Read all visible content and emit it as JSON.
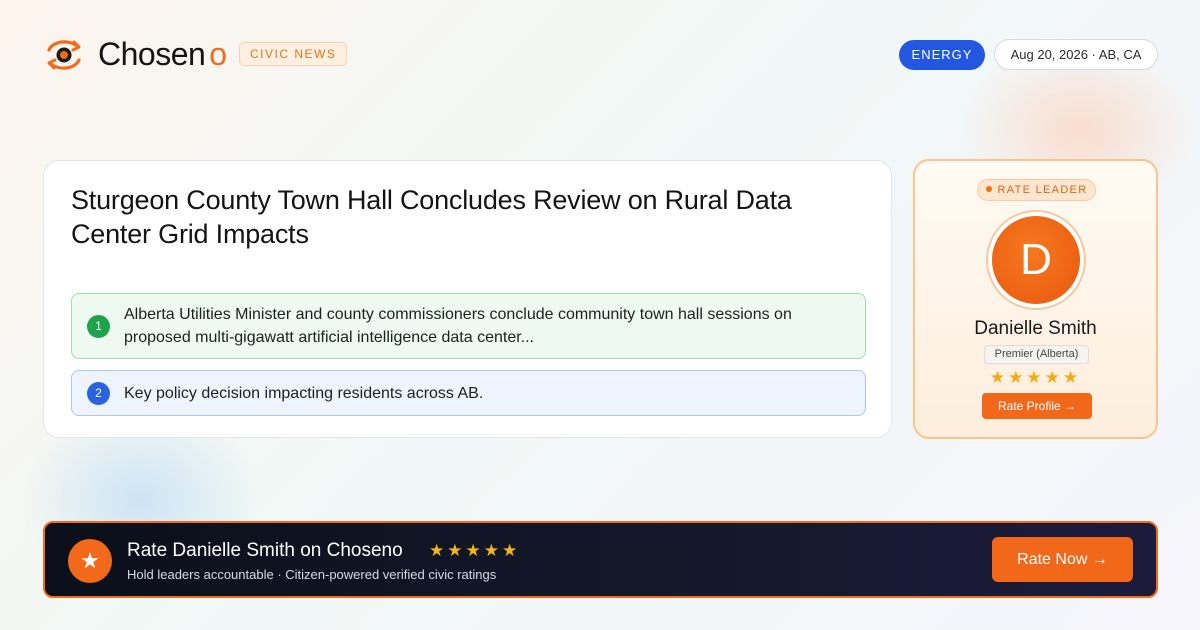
{
  "brand": {
    "name": "Chosen",
    "accent": "o",
    "icon": "eye-arrows-icon",
    "badge": "CIVIC NEWS"
  },
  "header": {
    "category": "ENERGY",
    "date_location": "Aug 20, 2026 · AB, CA"
  },
  "article": {
    "headline": "Sturgeon County Town Hall Concludes Review on Rural Data Center Grid Impacts",
    "points": [
      {
        "number": "1",
        "text": "Alberta Utilities Minister and county commissioners conclude community town hall sessions on proposed multi-gigawatt artificial intelligence data center..."
      },
      {
        "number": "2",
        "text": "Key policy decision impacting residents across AB."
      }
    ]
  },
  "leader": {
    "tag": "RATE LEADER",
    "initial": "D",
    "name": "Danielle Smith",
    "role": "Premier (Alberta)",
    "stars": "★★★★★",
    "button": "Rate Profile →"
  },
  "banner": {
    "title": "Rate Danielle Smith on Choseno",
    "stars": "★★★★★",
    "subtitle": "Hold leaders accountable · Citizen-powered verified civic ratings",
    "button": "Rate Now →"
  },
  "colors": {
    "accent": "#f26b1d",
    "energy_blue": "#2457e0",
    "point1_green": "#1fa34a",
    "point2_blue": "#2a63e0",
    "star_gold": "#f2ab14"
  }
}
